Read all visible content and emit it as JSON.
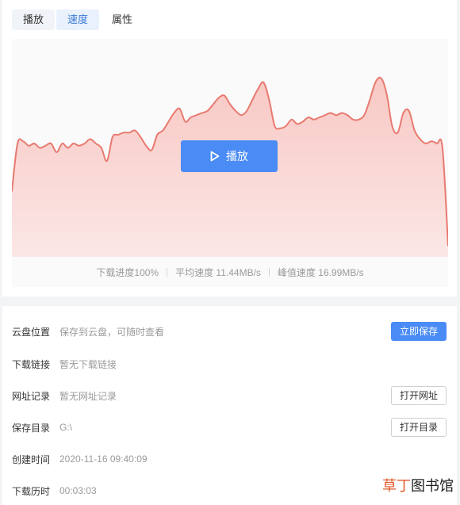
{
  "tabs": [
    {
      "label": "播放"
    },
    {
      "label": "速度"
    },
    {
      "label": "属性"
    }
  ],
  "player": {
    "play_label": "播放"
  },
  "chart_data": {
    "type": "area",
    "title": "",
    "xlabel": "",
    "ylabel": "",
    "color_line": "#e87a70",
    "color_fill_top": "#f8c8c4",
    "color_fill_bottom": "#fbe7e6",
    "values": [
      30,
      52,
      53,
      51,
      52,
      50,
      51,
      52,
      48,
      52,
      50,
      52,
      51,
      52,
      54,
      52,
      50,
      44,
      55,
      56,
      57,
      57,
      58,
      55,
      51,
      49,
      56,
      58,
      62,
      66,
      68,
      62,
      64,
      65,
      66,
      67,
      70,
      73,
      74,
      70,
      67,
      65,
      67,
      72,
      77,
      80,
      72,
      60,
      59,
      60,
      63,
      61,
      62,
      64,
      63,
      64,
      65,
      66,
      65,
      66,
      65,
      63,
      63,
      65,
      72,
      80,
      82,
      75,
      60,
      57,
      66,
      67,
      58,
      54,
      52,
      53,
      52,
      50,
      5
    ],
    "ylim": [
      0,
      100
    ]
  },
  "stats": {
    "progress": "下载进度100%",
    "avg_speed": "平均速度 11.44MB/s",
    "peak_speed": "峰值速度 16.99MB/s"
  },
  "details": {
    "cloud": {
      "label": "云盘位置",
      "value": "保存到云盘，可随时查看",
      "button": "立即保存"
    },
    "link": {
      "label": "下载链接",
      "value": "暂无下载链接"
    },
    "url": {
      "label": "网址记录",
      "value": "暂无网址记录",
      "button": "打开网址"
    },
    "dir": {
      "label": "保存目录",
      "value": "G:\\",
      "button": "打开目录"
    },
    "created": {
      "label": "创建时间",
      "value": "2020-11-16 09:40:09"
    },
    "duration": {
      "label": "下载历时",
      "value": "00:03:03"
    }
  },
  "watermark": {
    "brand_a": "草丁",
    "brand_b": "图书馆"
  }
}
